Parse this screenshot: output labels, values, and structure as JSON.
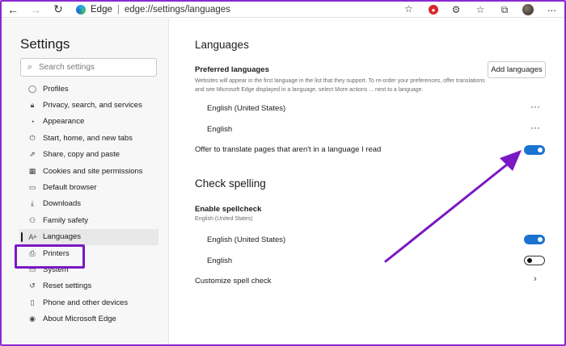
{
  "toolbar": {
    "back_icon": "arrow-left-icon",
    "forward_icon": "arrow-right-icon",
    "refresh_icon": "refresh-icon",
    "site_label": "Edge",
    "separator": "|",
    "url": "edge://settings/languages",
    "icons": [
      "favorite-add-icon",
      "adblock-icon",
      "extension-icon",
      "favorites-icon",
      "collections-icon",
      "profile-avatar",
      "more-icon"
    ]
  },
  "sidebar": {
    "title": "Settings",
    "search_placeholder": "Search settings",
    "items": [
      {
        "label": "Profiles",
        "icon": "profile-icon",
        "glyph": "◯"
      },
      {
        "label": "Privacy, search, and services",
        "icon": "lock-icon",
        "glyph": "🔒︎"
      },
      {
        "label": "Appearance",
        "icon": "appearance-icon",
        "glyph": "◔"
      },
      {
        "label": "Start, home, and new tabs",
        "icon": "power-icon",
        "glyph": "⏻"
      },
      {
        "label": "Share, copy and paste",
        "icon": "share-icon",
        "glyph": "⇗"
      },
      {
        "label": "Cookies and site permissions",
        "icon": "cookies-icon",
        "glyph": "▦"
      },
      {
        "label": "Default browser",
        "icon": "browser-icon",
        "glyph": "▭"
      },
      {
        "label": "Downloads",
        "icon": "download-icon",
        "glyph": "⤓"
      },
      {
        "label": "Family safety",
        "icon": "family-icon",
        "glyph": "⚇"
      },
      {
        "label": "Languages",
        "icon": "languages-icon",
        "glyph": "Aᵃ"
      },
      {
        "label": "Printers",
        "icon": "printer-icon",
        "glyph": "⎙"
      },
      {
        "label": "System",
        "icon": "system-icon",
        "glyph": "▭"
      },
      {
        "label": "Reset settings",
        "icon": "reset-icon",
        "glyph": "↺"
      },
      {
        "label": "Phone and other devices",
        "icon": "phone-icon",
        "glyph": "▯"
      },
      {
        "label": "About Microsoft Edge",
        "icon": "edge-icon",
        "glyph": "◉"
      }
    ],
    "active_index": 9
  },
  "main": {
    "languages_title": "Languages",
    "preferred_label": "Preferred languages",
    "preferred_desc": "Websites will appear in the first language in the list that they support. To re-order your preferences, offer translations and see Microsoft Edge displayed in a language, select More actions ... next to a language.",
    "add_languages": "Add languages",
    "preferred_list": [
      "English (United States)",
      "English"
    ],
    "more_actions": "···",
    "offer_translate": "Offer to translate pages that aren't in a language I read",
    "offer_translate_on": true,
    "spell_title": "Check spelling",
    "enable_spellcheck": "Enable spellcheck",
    "spell_sub": "English (United States)",
    "spell_list": [
      {
        "label": "English (United States)",
        "on": true
      },
      {
        "label": "English",
        "on": false
      }
    ],
    "customize": "Customize spell check",
    "chevron": "›"
  },
  "colors": {
    "accent": "#1a73d1",
    "annotation": "#7a18c4"
  }
}
